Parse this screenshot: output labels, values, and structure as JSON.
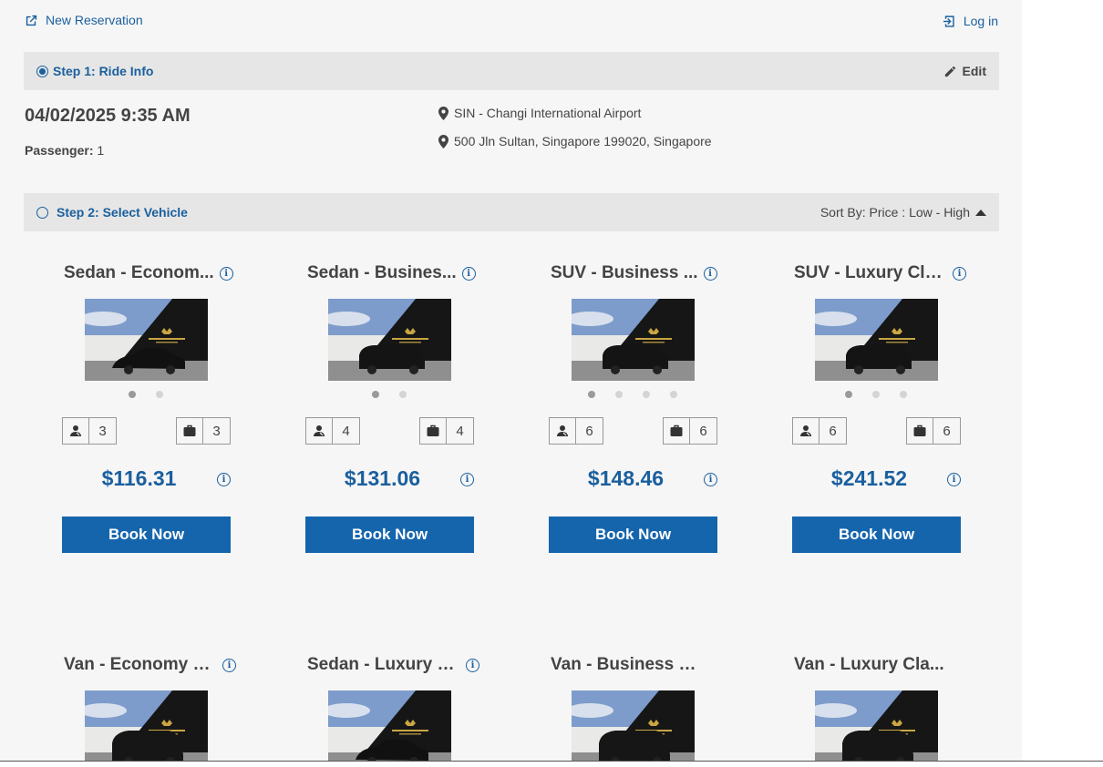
{
  "header": {
    "new_reservation": "New Reservation",
    "login": "Log in"
  },
  "step1": {
    "title": "Step 1: Ride Info",
    "edit": "Edit",
    "datetime": "04/02/2025 9:35 AM",
    "passenger_label": "Passenger:",
    "passenger_count": "1",
    "pickup": "SIN - Changi International Airport",
    "dropoff": "500 Jln Sultan, Singapore 199020, Singapore"
  },
  "step2": {
    "title": "Step 2: Select Vehicle",
    "sort": "Sort By: Price : Low - High"
  },
  "vehicles": [
    {
      "name": "Sedan - Econom...",
      "passengers": "3",
      "luggage": "3",
      "price": "$116.31",
      "book": "Book Now",
      "photos": 2,
      "car": "sedan"
    },
    {
      "name": "Sedan - Busines...",
      "passengers": "4",
      "luggage": "4",
      "price": "$131.06",
      "book": "Book Now",
      "photos": 2,
      "car": "suv"
    },
    {
      "name": "SUV - Business ...",
      "passengers": "6",
      "luggage": "6",
      "price": "$148.46",
      "book": "Book Now",
      "photos": 4,
      "car": "suv"
    },
    {
      "name": "SUV - Luxury Cla...",
      "passengers": "6",
      "luggage": "6",
      "price": "$241.52",
      "book": "Book Now",
      "photos": 3,
      "car": "suv"
    },
    {
      "name": "Van - Economy C...",
      "car": "van"
    },
    {
      "name": "Sedan - Luxury C...",
      "car": "sedan"
    },
    {
      "name": "Van - Business C...",
      "car": "van"
    },
    {
      "name": "Van - Luxury Cla...",
      "car": "van"
    }
  ],
  "colors": {
    "accent": "#1a5f9e",
    "button": "#1565ad",
    "bar": "#e6e6e6",
    "page": "#f6f6f6"
  }
}
